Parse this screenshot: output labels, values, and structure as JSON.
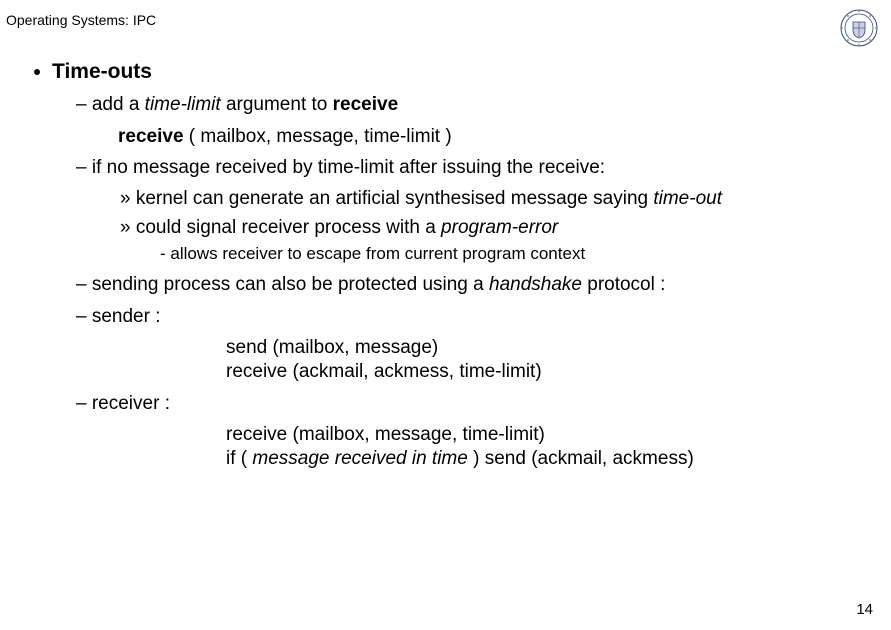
{
  "header": "Operating Systems: IPC",
  "pagenum": "14",
  "crest_alt": "university-crest",
  "l1": "Time-outs",
  "l2a_pre": "– add a ",
  "l2a_it": "time-limit",
  "l2a_mid": " argument to ",
  "l2a_bold": "receive",
  "code1_bold": "receive",
  "code1_rest": " ( mailbox, message, time-limit )",
  "l2b": "– if no message received by time-limit after issuing the receive:",
  "l3a_pre": "» kernel can generate an artificial synthesised message saying ",
  "l3a_it": "time-out",
  "l3b_pre": "» could signal receiver process with a ",
  "l3b_it": "program-error",
  "l4": "-  allows receiver to escape from current program context",
  "l2c_pre": "– sending process can also be protected using a ",
  "l2c_it": "handshake",
  "l2c_post": " protocol :",
  "sender_label": "– sender :",
  "sender_line1": "send (mailbox, message)",
  "sender_line2": "receive (ackmail, ackmess, time-limit)",
  "receiver_label": "– receiver :",
  "receiver_line1": "receive (mailbox, message, time-limit)",
  "receiver_line2a": "if ( ",
  "receiver_line2it": "message received in time",
  "receiver_line2b": " ) send (ackmail, ackmess)"
}
